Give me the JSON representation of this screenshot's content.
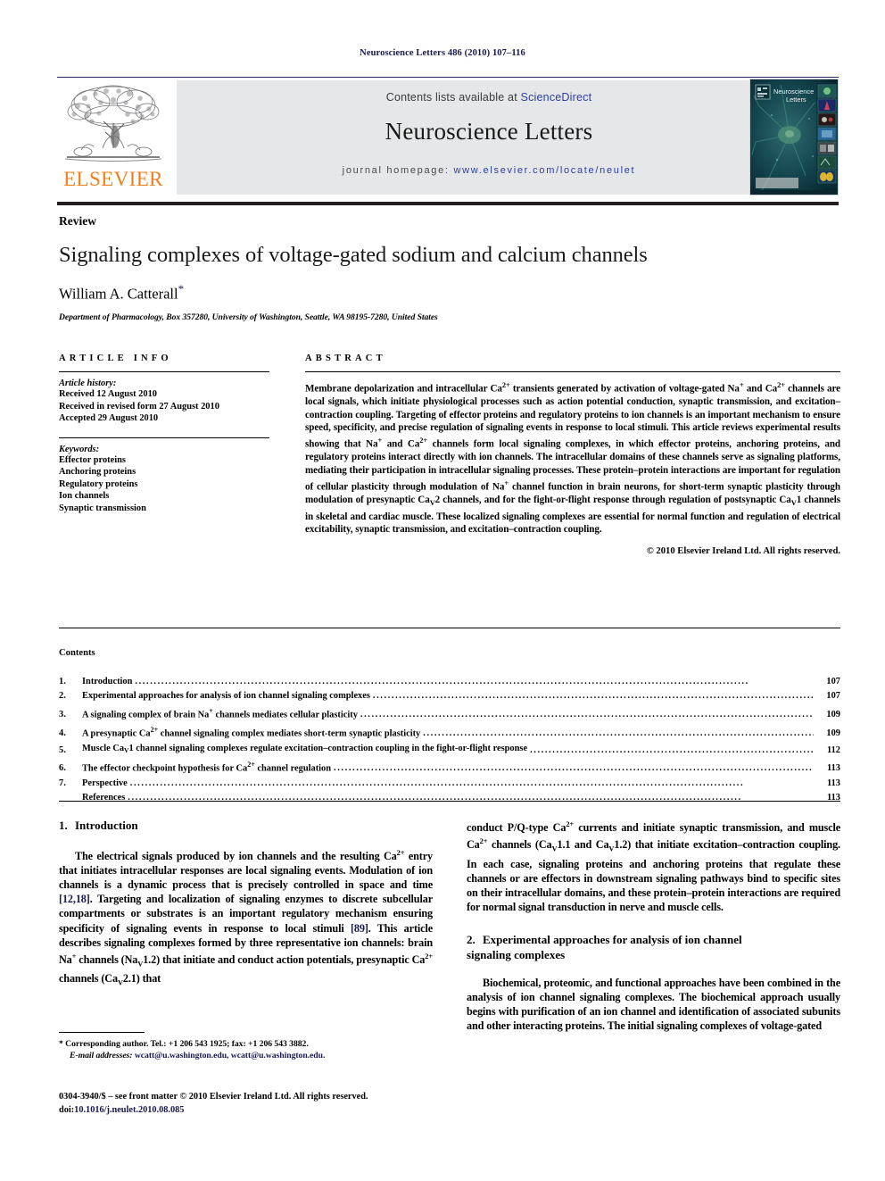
{
  "running_head": "Neuroscience Letters 486 (2010) 107–116",
  "masthead": {
    "contents_prefix": "Contents lists available at ",
    "sciencedirect": "ScienceDirect",
    "journal_title": "Neuroscience Letters",
    "homepage_prefix": "journal homepage: ",
    "homepage_url": "www.elsevier.com/locate/neulet",
    "publisher_wordmark": "ELSEVIER",
    "cover_title_line1": "Neuroscience",
    "cover_title_line2": "Letters",
    "accent_orange": "#F07F19",
    "link_blue": "#2B3EA8",
    "grey_panel": "#E6E7E8"
  },
  "article": {
    "type": "Review",
    "title": "Signaling complexes of voltage-gated sodium and calcium channels",
    "author": "William A. Catterall",
    "author_marker": "*",
    "affiliation": "Department of Pharmacology, Box 357280, University of Washington, Seattle, WA 98195-7280, United States"
  },
  "article_info": {
    "heading": "ARTICLE INFO",
    "history_label": "Article history:",
    "history": [
      "Received 12 August 2010",
      "Received in revised form 27 August 2010",
      "Accepted 29 August 2010"
    ],
    "keywords_label": "Keywords:",
    "keywords": [
      "Effector proteins",
      "Anchoring proteins",
      "Regulatory proteins",
      "Ion channels",
      "Synaptic transmission"
    ]
  },
  "abstract": {
    "heading": "ABSTRACT",
    "paragraphs": [
      "Membrane depolarization and intracellular Ca2+ transients generated by activation of voltage-gated Na+ and Ca2+ channels are local signals, which initiate physiological processes such as action potential conduction, synaptic transmission, and excitation–contraction coupling. Targeting of effector proteins and regulatory proteins to ion channels is an important mechanism to ensure speed, specificity, and precise regulation of signaling events in response to local stimuli. This article reviews experimental results showing that Na+ and Ca2+ channels form local signaling complexes, in which effector proteins, anchoring proteins, and regulatory proteins interact directly with ion channels. The intracellular domains of these channels serve as signaling platforms, mediating their participation in intracellular signaling processes. These protein–protein interactions are important for regulation of cellular plasticity through modulation of Na+ channel function in brain neurons, for short-term synaptic plasticity through modulation of presynaptic CaV2 channels, and for the fight-or-flight response through regulation of postsynaptic CaV1 channels in skeletal and cardiac muscle. These localized signaling complexes are essential for normal function and regulation of electrical excitability, synaptic transmission, and excitation–contraction coupling."
    ],
    "copyright": "© 2010 Elsevier Ireland Ltd. All rights reserved."
  },
  "contents": {
    "heading": "Contents",
    "entries": [
      {
        "num": "1.",
        "label": "Introduction",
        "page": "107"
      },
      {
        "num": "2.",
        "label": "Experimental approaches for analysis of ion channel signaling complexes",
        "page": "107"
      },
      {
        "num": "3.",
        "label": "A signaling complex of brain Na+ channels mediates cellular plasticity",
        "page": "109"
      },
      {
        "num": "4.",
        "label": "A presynaptic Ca2+ channel signaling complex mediates short-term synaptic plasticity",
        "page": "109"
      },
      {
        "num": "5.",
        "label": "Muscle CaV1 channel signaling complexes regulate excitation–contraction coupling in the fight-or-flight response",
        "page": "112"
      },
      {
        "num": "6.",
        "label": "The effector checkpoint hypothesis for Ca2+ channel regulation",
        "page": "113"
      },
      {
        "num": "7.",
        "label": "Perspective",
        "page": "113"
      },
      {
        "num": "",
        "label": "References",
        "page": "113"
      }
    ]
  },
  "body": {
    "section1": {
      "num": "1.",
      "title": "Introduction",
      "para1_a": "The electrical signals produced by ion channels and the resulting Ca",
      "para1_ref1": "[12,18]",
      "para1_ref2": "[89]"
    },
    "section2": {
      "num": "2.",
      "title_line1": "Experimental approaches for analysis of ion channel",
      "title_line2": "signaling complexes"
    }
  },
  "footnotes": {
    "corresponding": "* Corresponding author. Tel.: +1 206 543 1925; fax: +1 206 543 3882.",
    "email_label": "E-mail addresses:",
    "emails": "wcatt@u.washington.edu, wcatt@u.washington.edu.",
    "imprint": "0304-3940/$ – see front matter © 2010 Elsevier Ireland Ltd. All rights reserved.",
    "doi_label": "doi:",
    "doi": "10.1016/j.neulet.2010.08.085"
  }
}
